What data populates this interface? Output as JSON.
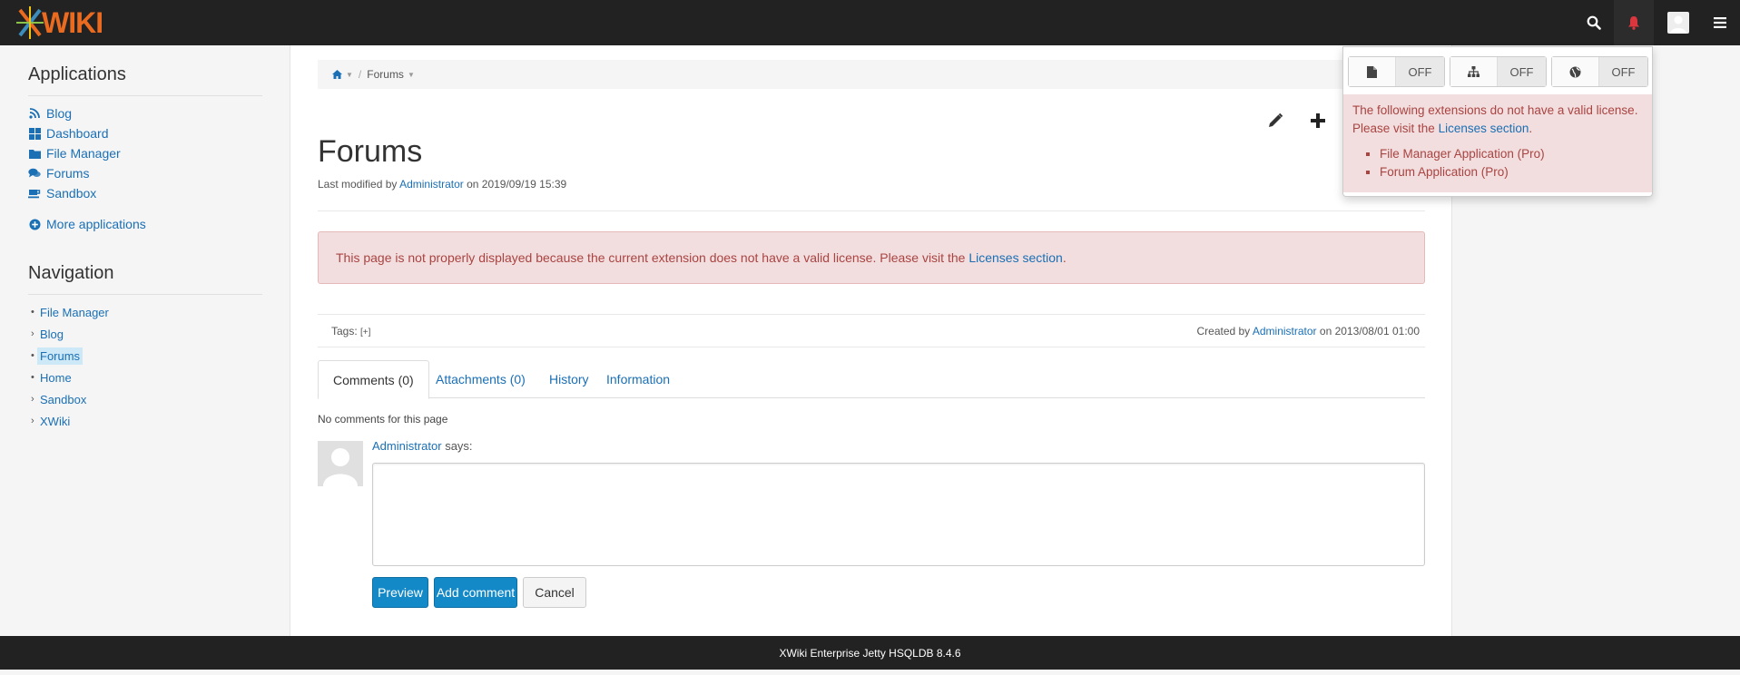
{
  "app": {
    "logo_text": "WIKI",
    "brand_color": "#ea6b1f",
    "topbar_color": "#222222"
  },
  "topbar": {
    "icons": [
      "search-icon",
      "bell-icon",
      "user-avatar-icon",
      "hamburger-menu-icon"
    ]
  },
  "sidebar": {
    "applications_title": "Applications",
    "apps": [
      {
        "label": "Blog",
        "icon": "rss-icon"
      },
      {
        "label": "Dashboard",
        "icon": "grid-icon"
      },
      {
        "label": "File Manager",
        "icon": "folder-icon"
      },
      {
        "label": "Forums",
        "icon": "comments-icon"
      },
      {
        "label": "Sandbox",
        "icon": "cup-icon"
      }
    ],
    "more_apps": "More applications",
    "navigation_title": "Navigation",
    "nav": [
      {
        "label": "File Manager",
        "marker": "•"
      },
      {
        "label": "Blog",
        "marker": "›"
      },
      {
        "label": "Forums",
        "marker": "•"
      },
      {
        "label": "Home",
        "marker": "•"
      },
      {
        "label": "Sandbox",
        "marker": "›"
      },
      {
        "label": "XWiki",
        "marker": "›"
      }
    ]
  },
  "breadcrumb": {
    "home_icon": "home-icon",
    "current": "Forums"
  },
  "page": {
    "title": "Forums",
    "modified_prefix": "Last modified by",
    "modified_by": "Administrator",
    "modified_on": "on 2019/09/19 15:39",
    "license_message": "This page is not properly displayed because the current extension does not have a valid license. Please visit the",
    "license_link": "Licenses section",
    "license_suffix": ".",
    "tags_label": "Tags:",
    "tags_add": "[+]",
    "created_prefix": "Created by",
    "created_by": "Administrator",
    "created_on": "on 2013/08/01 01:00"
  },
  "tabs": [
    {
      "label": "Comments (0)",
      "active": true
    },
    {
      "label": "Attachments (0)",
      "active": false
    },
    {
      "label": "History",
      "active": false
    },
    {
      "label": "Information",
      "active": false
    }
  ],
  "comments": {
    "empty_text": "No comments for this page",
    "author": "Administrator",
    "says": "says:",
    "textarea_value": "",
    "preview_label": "Preview",
    "add_label": "Add comment",
    "cancel_label": "Cancel"
  },
  "footer": {
    "text": "XWiki Enterprise Jetty HSQLDB 8.4.6"
  },
  "notifications": {
    "toggles": [
      {
        "icon": "page-icon",
        "state": "OFF"
      },
      {
        "icon": "sitemap-icon",
        "state": "OFF"
      },
      {
        "icon": "globe-icon",
        "state": "OFF"
      }
    ],
    "alert_text": "The following extensions do not have a valid license. Please visit the",
    "alert_link": "Licenses section",
    "alert_suffix": ".",
    "extensions": [
      "File Manager Application (Pro)",
      "Forum Application (Pro)"
    ]
  }
}
